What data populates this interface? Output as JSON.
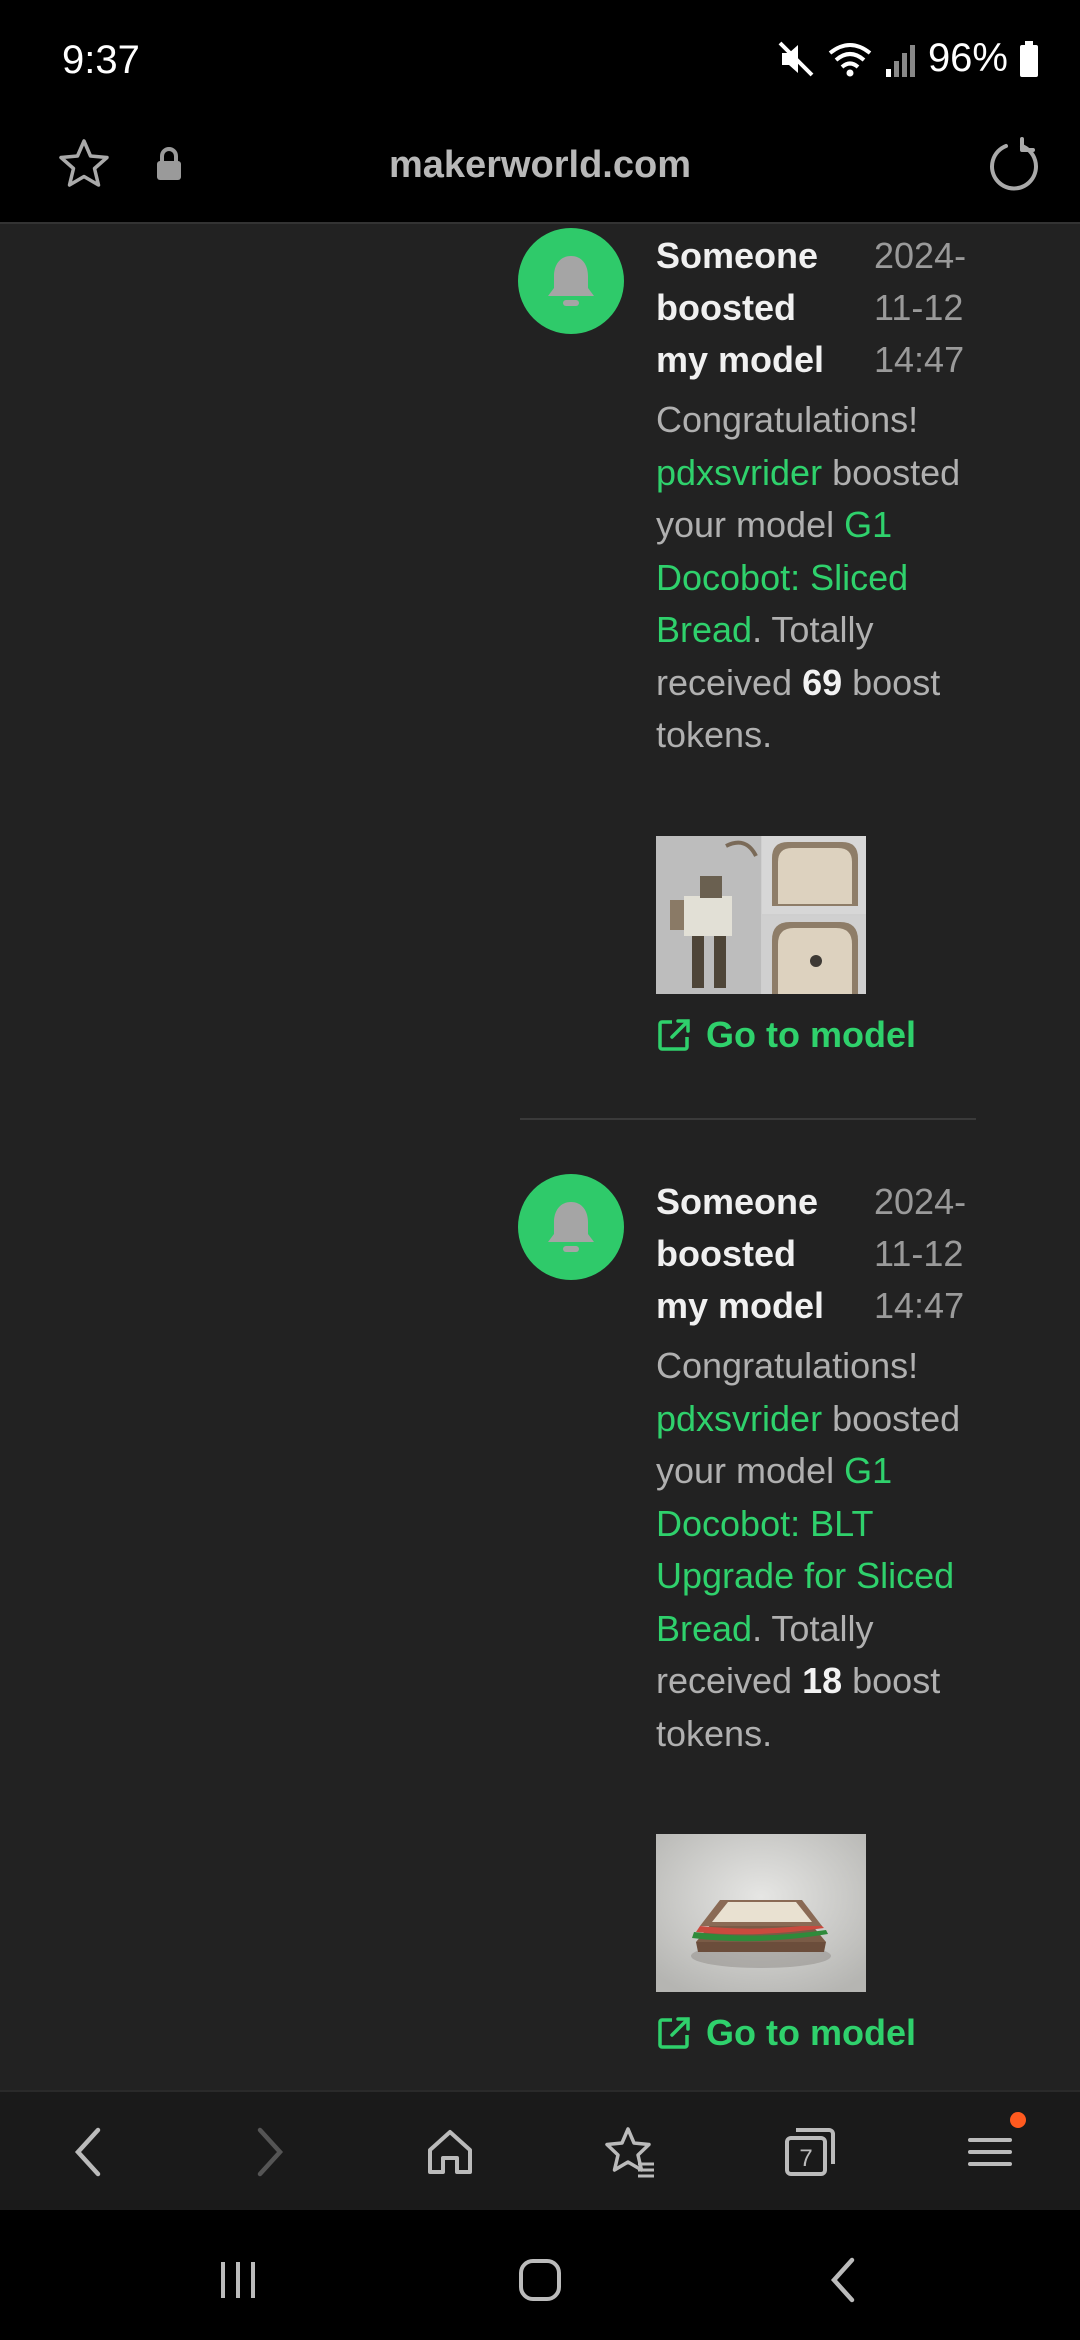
{
  "status_bar": {
    "time": "9:37",
    "battery": "96%",
    "icons": [
      "mute-icon",
      "wifi-icon",
      "signal-icon",
      "battery-icon"
    ]
  },
  "url_bar": {
    "url": "makerworld.com"
  },
  "notifications": [
    {
      "title": "Someone boosted my model",
      "date_lines": [
        "2024-",
        "11-12",
        "14:47"
      ],
      "intro": "Congratulations!",
      "user": "pdxsvrider",
      "middle": " boosted your model ",
      "model": "G1 Docobot: Sliced Bread",
      "after_model": ". Totally received ",
      "count": "69",
      "tail": " boost tokens.",
      "goto_label": "Go to model",
      "thumb": "robot-bread-thumbnail"
    },
    {
      "title": "Someone boosted my model",
      "date_lines": [
        "2024-",
        "11-12",
        "14:47"
      ],
      "intro": "Congratulations!",
      "user": "pdxsvrider",
      "middle": " boosted your model ",
      "model": "G1 Docobot: BLT Upgrade for Sliced Bread",
      "after_model": ". Totally received ",
      "count": "18",
      "tail": " boost tokens.",
      "goto_label": "Go to model",
      "thumb": "sandwich-thumbnail"
    }
  ],
  "browser_nav": {
    "tabs_count": "7"
  },
  "colors": {
    "accent": "#2fd16c",
    "background": "#222222",
    "notification_dot": "#ff5a1f"
  }
}
